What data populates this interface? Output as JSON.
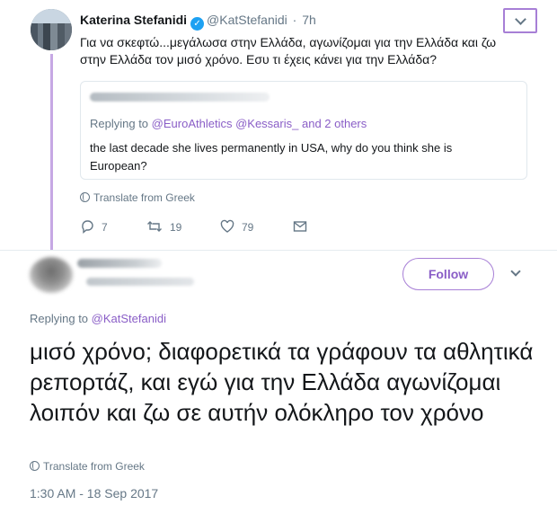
{
  "tweet": {
    "author_name": "Katerina Stefanidi",
    "verified_mark": "✓",
    "handle": "@KatStefanidi",
    "separator": "·",
    "time": "7h",
    "text": "Για να σκεφτώ...μεγάλωσα στην Ελλάδα, αγωνίζομαι για την Ελλάδα και ζω στην Ελλάδα τον μισό χρόνο. Εσυ τι έχεις κάνει για την Ελλάδα?",
    "quoted": {
      "replying_prefix": "Replying to",
      "mentions": "@EuroAthletics @Kessaris_",
      "others_text": "and 2 others",
      "text": "the last decade she lives permanently in USA, why do you think she is European?"
    },
    "translate_label": "Translate from Greek",
    "actions": {
      "replies": "7",
      "retweets": "19",
      "likes": "79"
    }
  },
  "reply": {
    "follow_label": "Follow",
    "replying_prefix": "Replying to",
    "replying_mention": "@KatStefanidi",
    "text": "μισό χρόνο; διαφορετικά τα γράφουν τα αθλητικά ρεπορτάζ, και εγώ για την Ελλάδα αγωνίζομαι λοιπόν και ζω σε αυτήν ολόκληρο τον χρόνο",
    "translate_label": "Translate from Greek",
    "timestamp": "1:30 AM - 18 Sep 2017"
  },
  "colors": {
    "accent": "#8a5ec7",
    "accent_border": "#a77fd6",
    "thread_line": "#c6a8e4",
    "muted_text": "#657786",
    "verified_badge": "#1da1f2"
  },
  "icons": [
    "chevron-down-icon",
    "verified-badge-icon",
    "globe-icon",
    "reply-icon",
    "retweet-icon",
    "like-icon",
    "direct-message-icon"
  ]
}
